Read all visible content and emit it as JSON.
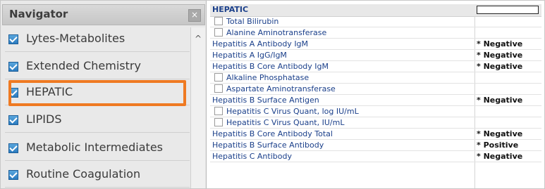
{
  "navigator": {
    "title": "Navigator",
    "close_icon": "×",
    "items": [
      {
        "label": "Lytes-Metabolites"
      },
      {
        "label": "Extended Chemistry"
      },
      {
        "label": "HEPATIC"
      },
      {
        "label": "LIPIDS"
      },
      {
        "label": "Metabolic Intermediates"
      },
      {
        "label": "Routine Coagulation"
      }
    ],
    "highlight_color": "#ef7a22"
  },
  "table": {
    "header": "HEPATIC",
    "rows": [
      {
        "name": "Total Bilirubin",
        "value": "",
        "sub": true
      },
      {
        "name": "Alanine Aminotransferase",
        "value": "",
        "sub": true
      },
      {
        "name": "Hepatitis A Antibody IgM",
        "value": "* Negative",
        "sub": false
      },
      {
        "name": "Hepatitis A IgG/IgM",
        "value": "* Negative",
        "sub": false
      },
      {
        "name": "Hepatitis B Core Antibody IgM",
        "value": "* Negative",
        "sub": false
      },
      {
        "name": "Alkaline Phosphatase",
        "value": "",
        "sub": true
      },
      {
        "name": "Aspartate Aminotransferase",
        "value": "",
        "sub": true
      },
      {
        "name": "Hepatitis B Surface Antigen",
        "value": "* Negative",
        "sub": false
      },
      {
        "name": "Hepatitis C Virus Quant, log IU/mL",
        "value": "",
        "sub": true
      },
      {
        "name": "Hepatitis C Virus Quant, IU/mL",
        "value": "",
        "sub": true
      },
      {
        "name": "Hepatitis B Core Antibody Total",
        "value": "* Negative",
        "sub": false
      },
      {
        "name": "Hepatitis B Surface Antibody",
        "value": "* Positive",
        "sub": false
      },
      {
        "name": "Hepatitis C Antibody",
        "value": "* Negative",
        "sub": false
      }
    ]
  }
}
